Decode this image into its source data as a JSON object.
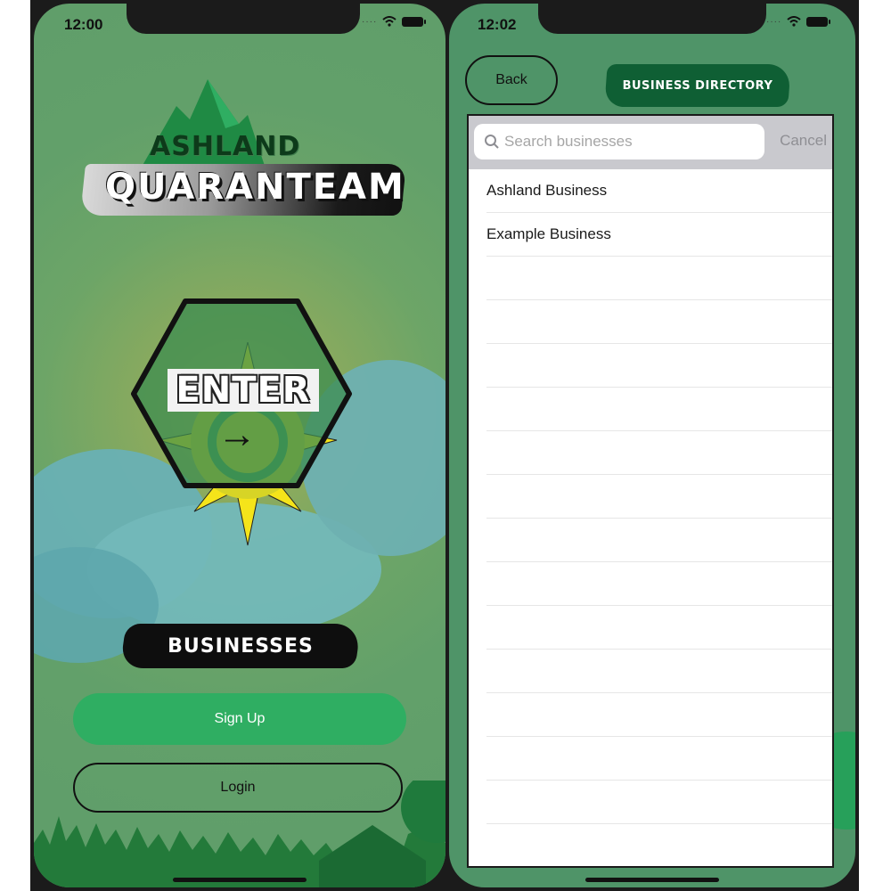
{
  "left_screen": {
    "status": {
      "time": "12:00"
    },
    "logo": {
      "line1": "ASHLAND",
      "line2": "QUARANTEAM"
    },
    "enter_button": {
      "label": "ENTER"
    },
    "businesses_label": "BUSINESSES",
    "signup_button": "Sign Up",
    "login_button": "Login",
    "colors": {
      "background": "#62a06a",
      "signup": "#2fae62",
      "cloud": "#6fb3b6"
    }
  },
  "right_screen": {
    "status": {
      "time": "12:02"
    },
    "back_button": "Back",
    "title": "BUSINESS DIRECTORY",
    "search": {
      "placeholder": "Search businesses",
      "cancel": "Cancel"
    },
    "businesses": [
      {
        "name": "Ashland Business"
      },
      {
        "name": "Example Business"
      }
    ],
    "colors": {
      "background": "#4f9468",
      "title_banner": "#0f5f34"
    }
  }
}
